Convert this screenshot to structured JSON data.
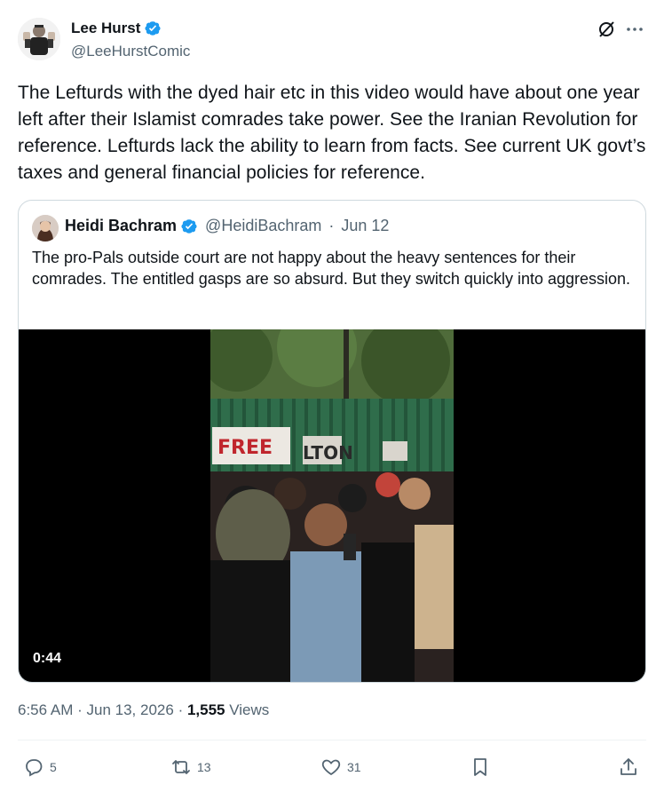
{
  "author": {
    "name": "Lee Hurst",
    "handle": "@LeeHurstComic"
  },
  "tweet": {
    "text": "The Lefturds with the dyed hair etc in this video would have about one year left after their Islamist comrades take power. See the Iranian Revolution for reference. Lefturds lack the ability to learn from facts. See current UK govt’s taxes and general financial policies for reference."
  },
  "quote": {
    "name": "Heidi Bachram",
    "handle": "@HeidiBachram",
    "separator": "·",
    "date": "Jun 12",
    "text": "The pro-Pals outside court are not happy about the heavy sentences for their comrades. The entitled gasps are so absurd. But they switch quickly into aggression.",
    "video": {
      "duration": "0:44",
      "banner_text": "FREE",
      "banner_text_2": "LTON"
    }
  },
  "meta": {
    "time": "6:56 AM",
    "dot1": "·",
    "date": "Jun 13, 2026",
    "dot2": "·",
    "views_count": "1,555",
    "views_label": "Views"
  },
  "actions": {
    "replies": "5",
    "reposts": "13",
    "likes": "31"
  },
  "colors": {
    "verified": "#1d9bf0",
    "text": "#0f1419",
    "secondary": "#536471",
    "border": "#cfd9de"
  },
  "icons": [
    "verified-badge-icon",
    "grok-icon",
    "more-icon",
    "reply-icon",
    "repost-icon",
    "like-icon",
    "bookmark-icon",
    "share-icon"
  ]
}
